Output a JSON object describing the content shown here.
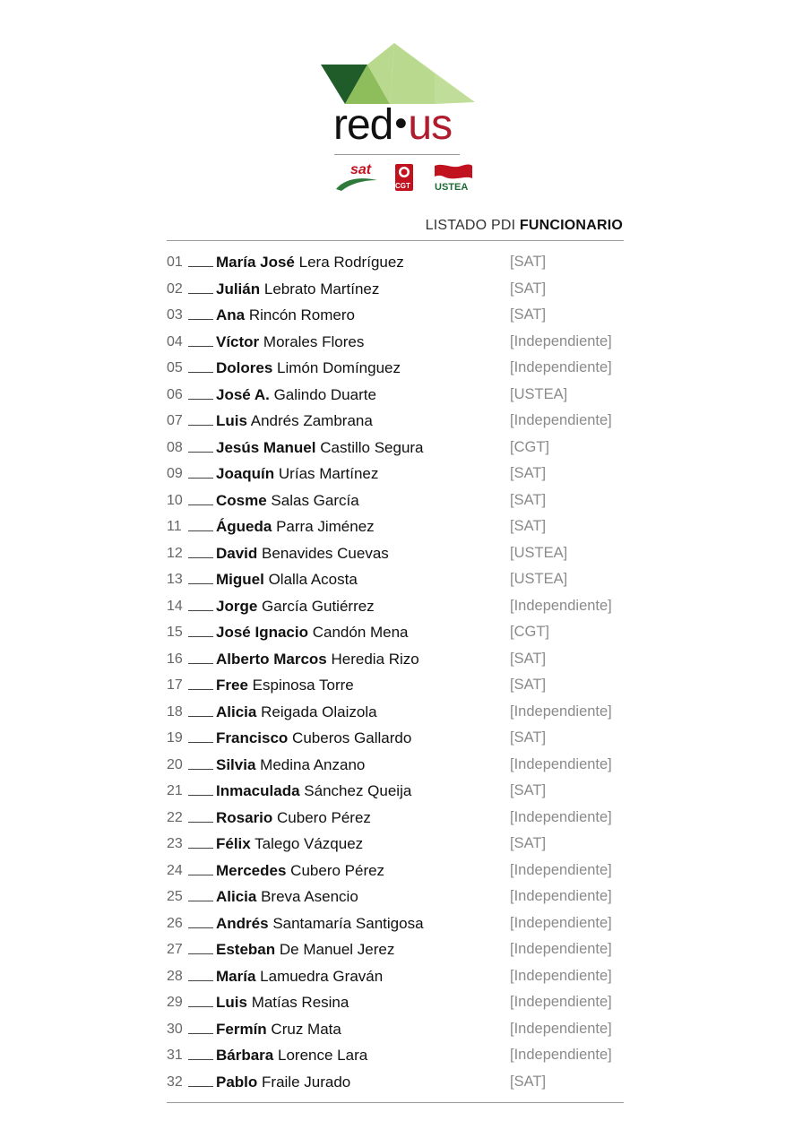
{
  "brand": {
    "left": "red",
    "dot": "•",
    "right": "us"
  },
  "unions": {
    "sat": "sat",
    "cgt": "CGT",
    "ustea": "USTEA"
  },
  "header": {
    "prefix": "LISTADO PDI",
    "bold": "FUNCIONARIO"
  },
  "colors": {
    "brand_red": "#b01c2e",
    "sat_red": "#c1121f",
    "ustea_green": "#1d6a36",
    "logo_dark_green": "#1f5c2a",
    "logo_mid_green": "#8ebd5c",
    "logo_light_green": "#b9d98e"
  },
  "candidates": [
    {
      "num": "01",
      "first": "María José",
      "last": "Lera Rodríguez",
      "aff": "[SAT]"
    },
    {
      "num": "02",
      "first": "Julián",
      "last": "Lebrato Martínez",
      "aff": "[SAT]"
    },
    {
      "num": "03",
      "first": "Ana",
      "last": "Rincón Romero",
      "aff": "[SAT]"
    },
    {
      "num": "04",
      "first": "Víctor",
      "last": "Morales Flores",
      "aff": "[Independiente]"
    },
    {
      "num": "05",
      "first": "Dolores",
      "last": "Limón Domínguez",
      "aff": "[Independiente]"
    },
    {
      "num": "06",
      "first": "José A.",
      "last": "Galindo Duarte",
      "aff": "[USTEA]"
    },
    {
      "num": "07",
      "first": "Luis",
      "last": "Andrés Zambrana",
      "aff": "[Independiente]"
    },
    {
      "num": "08",
      "first": "Jesús Manuel",
      "last": "Castillo Segura",
      "aff": "[CGT]"
    },
    {
      "num": "09",
      "first": "Joaquín",
      "last": "Urías Martínez",
      "aff": "[SAT]"
    },
    {
      "num": "10",
      "first": "Cosme",
      "last": "Salas García",
      "aff": "[SAT]"
    },
    {
      "num": "11",
      "first": "Águeda",
      "last": "Parra Jiménez",
      "aff": "[SAT]"
    },
    {
      "num": "12",
      "first": "David",
      "last": "Benavides Cuevas",
      "aff": "[USTEA]"
    },
    {
      "num": "13",
      "first": "Miguel",
      "last": "Olalla Acosta",
      "aff": "[USTEA]"
    },
    {
      "num": "14",
      "first": "Jorge",
      "last": "García Gutiérrez",
      "aff": "[Independiente]"
    },
    {
      "num": "15",
      "first": "José Ignacio",
      "last": "Candón Mena",
      "aff": "[CGT]"
    },
    {
      "num": "16",
      "first": "Alberto Marcos",
      "last": "Heredia Rizo",
      "aff": "[SAT]"
    },
    {
      "num": "17",
      "first": "Free",
      "last": "Espinosa Torre",
      "aff": "[SAT]"
    },
    {
      "num": "18",
      "first": "Alicia",
      "last": "Reigada Olaizola",
      "aff": "[Independiente]"
    },
    {
      "num": "19",
      "first": "Francisco",
      "last": "Cuberos Gallardo",
      "aff": "[SAT]"
    },
    {
      "num": "20",
      "first": "Silvia",
      "last": "Medina Anzano",
      "aff": "[Independiente]"
    },
    {
      "num": "21",
      "first": "Inmaculada",
      "last": "Sánchez Queija",
      "aff": "[SAT]"
    },
    {
      "num": "22",
      "first": "Rosario",
      "last": "Cubero Pérez",
      "aff": "[Independiente]"
    },
    {
      "num": "23",
      "first": "Félix",
      "last": "Talego Vázquez",
      "aff": "[SAT]"
    },
    {
      "num": "24",
      "first": "Mercedes",
      "last": "Cubero Pérez",
      "aff": "[Independiente]"
    },
    {
      "num": "25",
      "first": "Alicia",
      "last": "Breva Asencio",
      "aff": "[Independiente]"
    },
    {
      "num": "26",
      "first": "Andrés",
      "last": "Santamaría Santigosa",
      "aff": "[Independiente]"
    },
    {
      "num": "27",
      "first": "Esteban",
      "last": "De Manuel Jerez",
      "aff": "[Independiente]"
    },
    {
      "num": "28",
      "first": "María",
      "last": "Lamuedra Graván",
      "aff": "[Independiente]"
    },
    {
      "num": "29",
      "first": "Luis",
      "last": "Matías Resina",
      "aff": "[Independiente]"
    },
    {
      "num": "30",
      "first": "Fermín",
      "last": "Cruz Mata",
      "aff": "[Independiente]"
    },
    {
      "num": "31",
      "first": "Bárbara",
      "last": "Lorence Lara",
      "aff": "[Independiente]"
    },
    {
      "num": "32",
      "first": "Pablo",
      "last": "Fraile Jurado",
      "aff": "[SAT]"
    }
  ]
}
